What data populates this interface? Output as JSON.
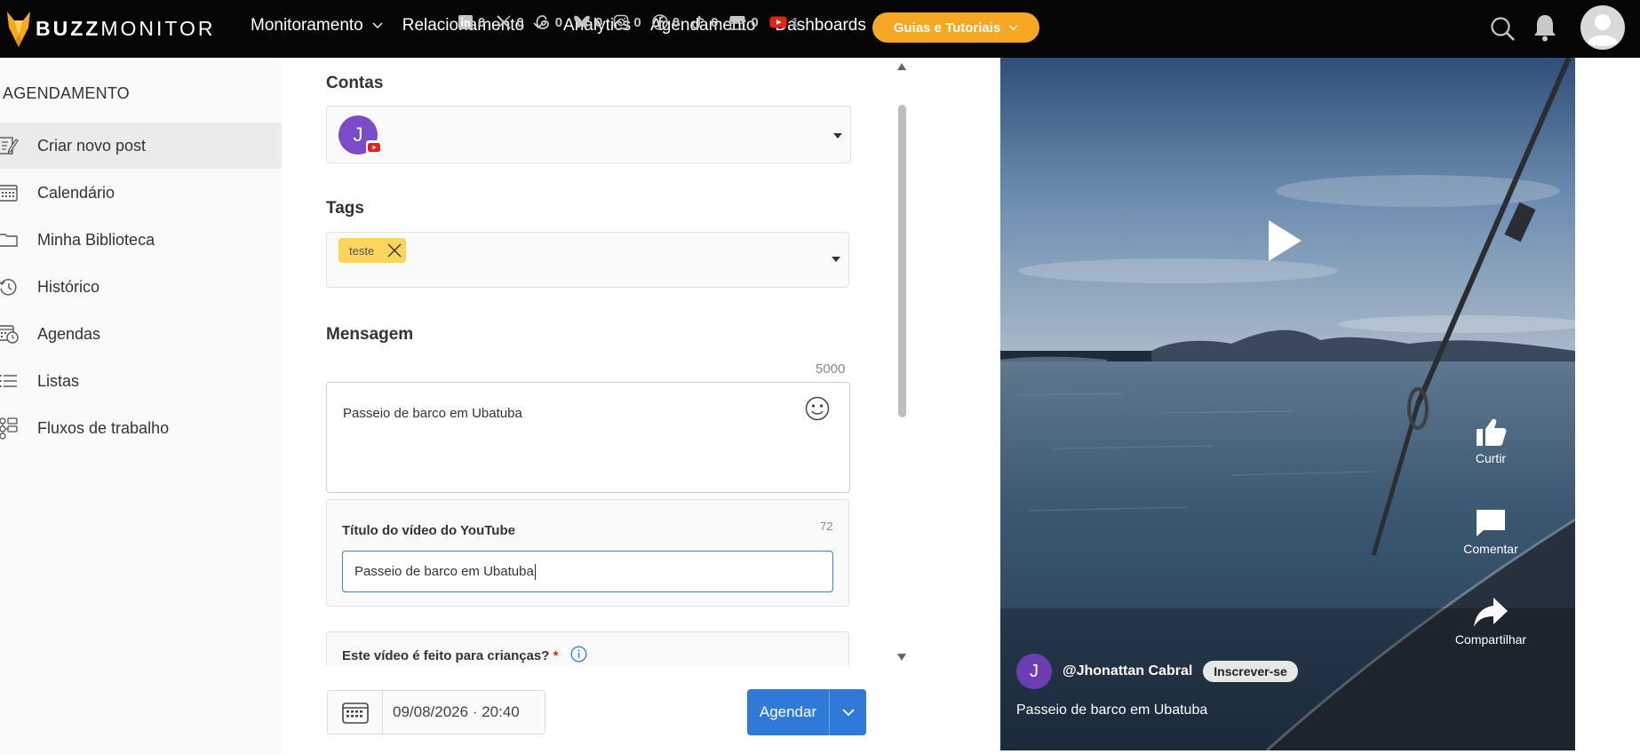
{
  "header": {
    "logo_bold": "BUZZ",
    "logo_light": "MONITOR",
    "nav": [
      {
        "label": "Monitoramento",
        "dropdown": true
      },
      {
        "label": "Relacionamento",
        "dropdown": true
      },
      {
        "label": "Analytics",
        "dropdown": false
      },
      {
        "label": "Agendamento",
        "dropdown": false
      },
      {
        "label": "Dashboards",
        "dropdown": false
      }
    ],
    "guides_button": "Guias e Tutoriais",
    "accent": "#f7a823"
  },
  "sidebar": {
    "heading": "AGENDAMENTO",
    "items": [
      {
        "label": "Criar novo post",
        "icon": "edit-icon",
        "active": true
      },
      {
        "label": "Calendário",
        "icon": "calendar-icon",
        "active": false
      },
      {
        "label": "Minha Biblioteca",
        "icon": "folder-icon",
        "active": false
      },
      {
        "label": "Histórico",
        "icon": "history-icon",
        "active": false
      },
      {
        "label": "Agendas",
        "icon": "calendar-clock-icon",
        "active": false
      },
      {
        "label": "Listas",
        "icon": "list-icon",
        "active": false
      },
      {
        "label": "Fluxos de trabalho",
        "icon": "workflow-icon",
        "active": false
      }
    ]
  },
  "form": {
    "contas_label": "Contas",
    "account_counts": [
      {
        "network": "linkedin",
        "count": "0"
      },
      {
        "network": "x",
        "count": "0"
      },
      {
        "network": "threads",
        "count": "0"
      },
      {
        "network": "bluesky",
        "count": "0"
      },
      {
        "network": "instagram",
        "count": "0"
      },
      {
        "network": "facebook",
        "count": "0"
      },
      {
        "network": "tiktok",
        "count": "0"
      },
      {
        "network": "google-business",
        "count": "0"
      },
      {
        "network": "youtube",
        "count": "1"
      }
    ],
    "selected_account_initial": "J",
    "tags_label": "Tags",
    "tags": [
      "teste"
    ],
    "mensagem_label": "Mensagem",
    "message_counter": "5000",
    "message_text": "Passeio de barco em Ubatuba",
    "yt_title_label": "Título do vídeo do YouTube",
    "yt_title_counter": "72",
    "yt_title_value": "Passeio de barco em Ubatuba",
    "kids_label": "Este vídeo é feito para crianças?",
    "kids_required": "*",
    "datetime": "09/08/2026 · 20:40",
    "submit_label": "Agendar"
  },
  "preview": {
    "actions": [
      {
        "label": "Curtir",
        "icon": "thumbs-up-icon"
      },
      {
        "label": "Comentar",
        "icon": "comment-icon"
      },
      {
        "label": "Compartilhar",
        "icon": "share-icon"
      }
    ],
    "channel_initial": "J",
    "channel_name": "@Jhonattan Cabral",
    "subscribe_label": "Inscrever-se",
    "video_title": "Passeio de barco em Ubatuba"
  }
}
